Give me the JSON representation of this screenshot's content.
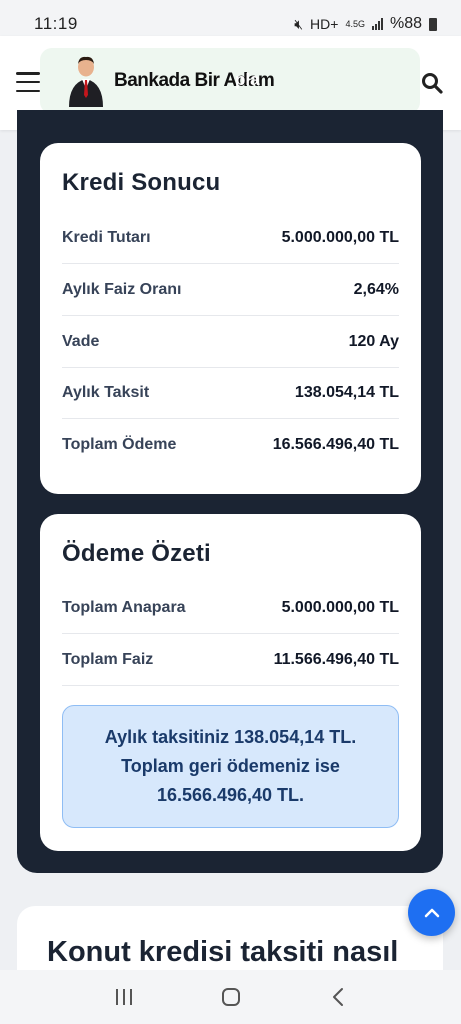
{
  "status_bar": {
    "time": "11:19",
    "mute_icon": "mute-icon",
    "hd_icon": "HD+",
    "network": "4.5G",
    "battery_text": "%88"
  },
  "header": {
    "logo_text": "Bankada Bir Adam",
    "background_word": "pla",
    "menu_icon": "hamburger-icon",
    "search_icon": "search-icon"
  },
  "loan_result": {
    "title": "Kredi Sonucu",
    "rows": [
      {
        "label": "Kredi Tutarı",
        "value": "5.000.000,00 TL"
      },
      {
        "label": "Aylık Faiz Oranı",
        "value": "2,64%"
      },
      {
        "label": "Vade",
        "value": "120 Ay"
      },
      {
        "label": "Aylık Taksit",
        "value": "138.054,14 TL"
      },
      {
        "label": "Toplam Ödeme",
        "value": "16.566.496,40 TL"
      }
    ]
  },
  "payment_summary": {
    "title": "Ödeme Özeti",
    "rows": [
      {
        "label": "Toplam Anapara",
        "value": "5.000.000,00 TL"
      },
      {
        "label": "Toplam Faiz",
        "value": "11.566.496,40 TL"
      }
    ],
    "summary_lines": [
      "Aylık taksitiniz 138.054,14 TL.",
      "Toplam geri ödemeniz ise",
      "16.566.496,40 TL."
    ]
  },
  "article": {
    "heading": "Konut kredisi taksiti nasıl"
  },
  "colors": {
    "dark_panel": "#1b2433",
    "accent": "#1e6ff2",
    "summary_bg": "#d7e8fc"
  }
}
